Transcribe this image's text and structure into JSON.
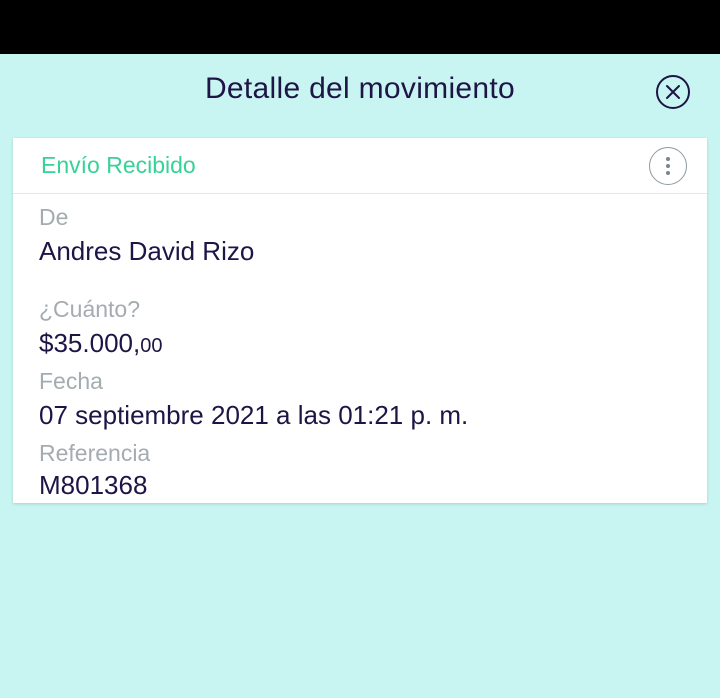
{
  "header": {
    "title": "Detalle del movimiento"
  },
  "card": {
    "title": "Envío Recibido",
    "fields": {
      "from": {
        "label": "De",
        "value": "Andres David Rizo"
      },
      "amount": {
        "label": "¿Cuánto?",
        "value_main": "$35.000,",
        "value_cents": "00"
      },
      "date": {
        "label": "Fecha",
        "value": "07 septiembre 2021 a las 01:21 p. m."
      },
      "reference": {
        "label": "Referencia",
        "value": "M801368"
      }
    }
  },
  "icons": {
    "close": "close-circle-icon",
    "menu": "more-vertical-icon"
  },
  "colors": {
    "background": "#c8f5f1",
    "accent": "#37d296",
    "text": "#1e1446",
    "label": "#a4acb0"
  }
}
